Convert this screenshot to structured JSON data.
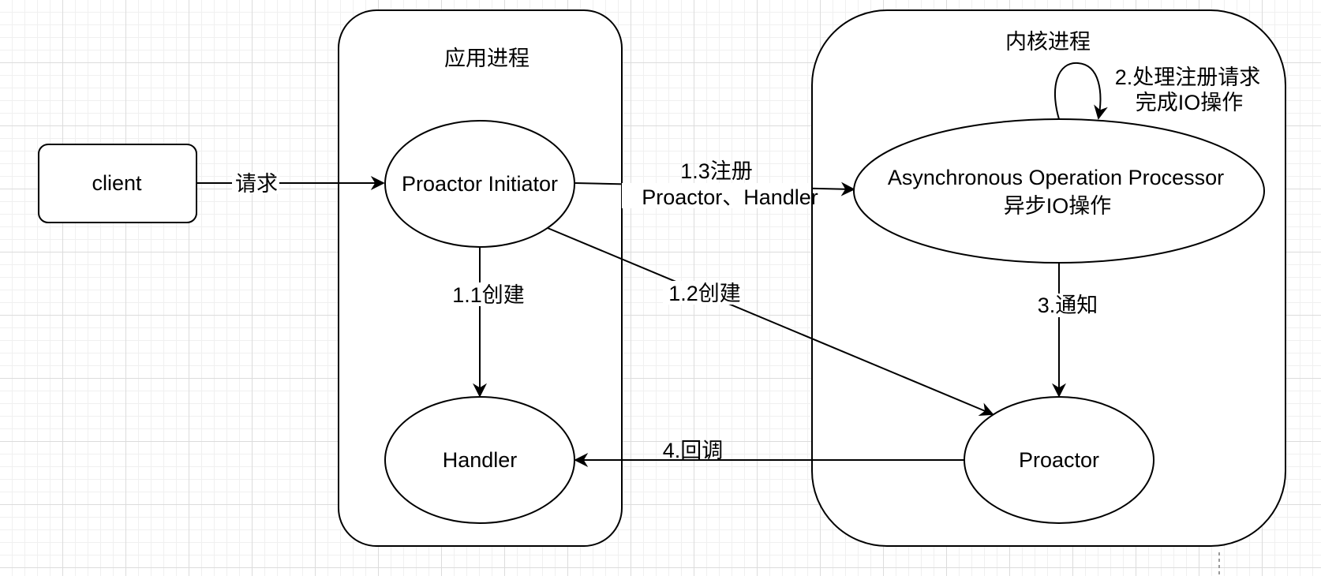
{
  "containers": {
    "app_process": "应用进程",
    "kernel_process": "内核进程"
  },
  "nodes": {
    "client": "client",
    "proactor_initiator": "Proactor Initiator",
    "handler": "Handler",
    "async_processor_line1": "Asynchronous Operation Processor",
    "async_processor_line2": "异步IO操作",
    "proactor": "Proactor"
  },
  "edges": {
    "request": "请求",
    "create_handler": "1.1创建",
    "create_proactor": "1.2创建",
    "register_line1": "1.3注册",
    "register_line2": "Proactor、Handler",
    "process_line1": "2.处理注册请求",
    "process_line2": "完成IO操作",
    "notify": "3.通知",
    "callback": "4.回调"
  }
}
